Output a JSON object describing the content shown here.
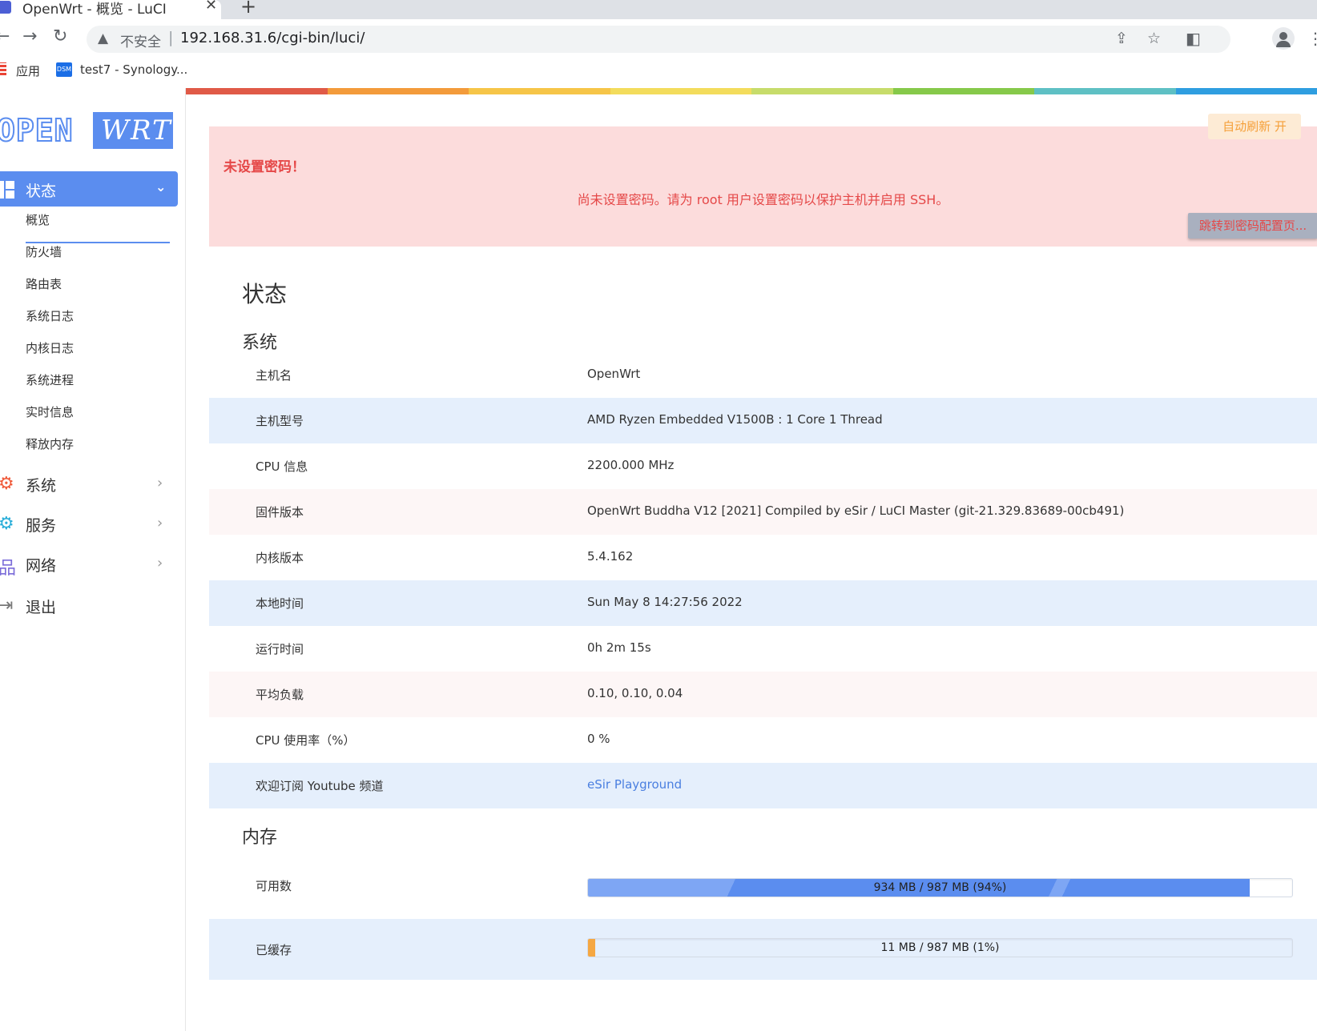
{
  "browser": {
    "tab_title": "OpenWrt - 概览 - LuCI",
    "tab_close": "✕",
    "new_tab": "+",
    "insecure_label": "不安全",
    "separator": "|",
    "url": "192.168.31.6/cgi-bin/luci/",
    "bookmarks": [
      {
        "label": "应用"
      },
      {
        "label": "test7 - Synology..."
      }
    ],
    "dsm_badge": "DSM"
  },
  "rainbow_colors": [
    "#e05a47",
    "#f39b3b",
    "#f6c548",
    "#f3dc5c",
    "#c7dc6b",
    "#86c94a",
    "#5ec0c4",
    "#2f9ee0"
  ],
  "sidebar": {
    "logo_left": "OPEN",
    "logo_right": "WRT",
    "active_menu": {
      "label": "状态",
      "chevron": "⌄"
    },
    "submenu": [
      "概览",
      "防火墙",
      "路由表",
      "系统日志",
      "内核日志",
      "系统进程",
      "实时信息",
      "释放内存"
    ],
    "menu": [
      {
        "label": "系统",
        "icon": "gear-icon",
        "chevron": "›"
      },
      {
        "label": "服务",
        "icon": "cogs-icon",
        "chevron": "›"
      },
      {
        "label": "网络",
        "icon": "network-icon",
        "chevron": "›"
      },
      {
        "label": "退出",
        "icon": "logout-icon"
      }
    ]
  },
  "main": {
    "auto_refresh": "自动刷新 开",
    "alert": {
      "title": "未设置密码！",
      "message": "尚未设置密码。请为 root 用户设置密码以保护主机并启用 SSH。",
      "button": "跳转到密码配置页..."
    },
    "page_title": "状态",
    "system_section": "系统",
    "system_rows": [
      {
        "key": "主机名",
        "value": "OpenWrt"
      },
      {
        "key": "主机型号",
        "value": "AMD Ryzen Embedded V1500B : 1 Core 1 Thread"
      },
      {
        "key": "CPU 信息",
        "value": "2200.000 MHz"
      },
      {
        "key": "固件版本",
        "value": "OpenWrt Buddha V12 [2021] Compiled by eSir / LuCI Master (git-21.329.83689-00cb491)"
      },
      {
        "key": "内核版本",
        "value": "5.4.162"
      },
      {
        "key": "本地时间",
        "value": "Sun May 8 14:27:56 2022"
      },
      {
        "key": "运行时间",
        "value": "0h 2m 15s"
      },
      {
        "key": "平均负载",
        "value": "0.10, 0.10, 0.04"
      },
      {
        "key": "CPU 使用率（%）",
        "value": "0 %"
      },
      {
        "key": "欢迎订阅 Youtube 频道",
        "value": "eSir Playground"
      }
    ],
    "memory_section": "内存",
    "memory_rows": [
      {
        "key": "可用数",
        "value": "934 MB / 987 MB (94%)",
        "percent": 94
      },
      {
        "key": "已缓存",
        "value": "11 MB / 987 MB (1%)",
        "percent": 1
      }
    ]
  }
}
